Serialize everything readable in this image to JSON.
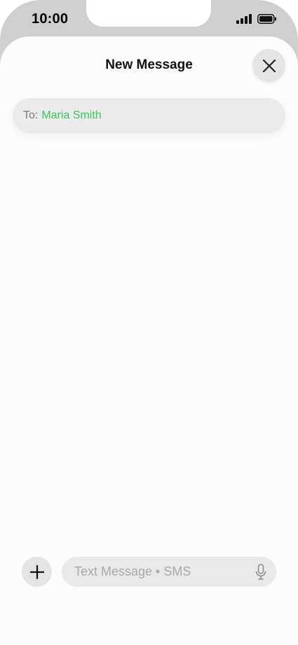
{
  "status_bar": {
    "time": "10:00",
    "icons": [
      "signal-icon",
      "battery-icon"
    ]
  },
  "sheet": {
    "title": "New Message",
    "close_icon": "close-icon"
  },
  "to_field": {
    "label": "To:",
    "recipient": "Maria Smith",
    "recipient_color": "#34c759"
  },
  "compose": {
    "add_icon": "plus-icon",
    "placeholder": "Text Message • SMS",
    "mic_icon": "microphone-icon"
  }
}
